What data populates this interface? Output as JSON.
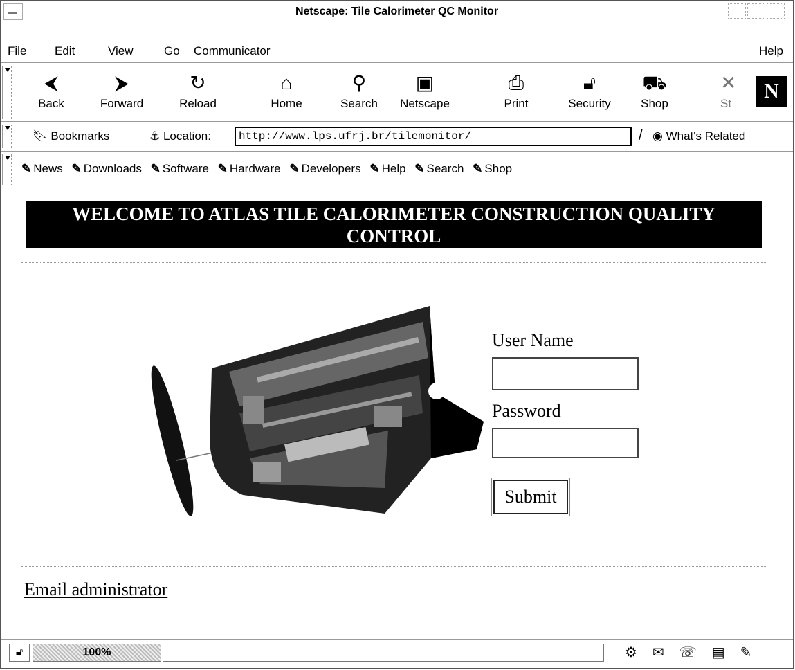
{
  "window": {
    "title": "Netscape: Tile Calorimeter QC Monitor"
  },
  "menu": {
    "file": "File",
    "edit": "Edit",
    "view": "View",
    "go": "Go",
    "communicator": "Communicator",
    "help": "Help"
  },
  "toolbar": {
    "back": "Back",
    "forward": "Forward",
    "reload": "Reload",
    "home": "Home",
    "search": "Search",
    "netscape": "Netscape",
    "print": "Print",
    "security": "Security",
    "shop": "Shop",
    "stop": "St"
  },
  "location": {
    "bookmarks": "Bookmarks",
    "label": "Location:",
    "url": "http://www.lps.ufrj.br/tilemonitor/",
    "whats_related": "What's Related"
  },
  "personal": {
    "news": "News",
    "downloads": "Downloads",
    "software": "Software",
    "hardware": "Hardware",
    "developers": "Developers",
    "help": "Help",
    "search": "Search",
    "shop": "Shop"
  },
  "page": {
    "banner": "WELCOME TO ATLAS TILE CALORIMETER CONSTRUCTION QUALITY CONTROL",
    "username_label": "User Name",
    "username_value": "",
    "password_label": "Password",
    "password_value": "",
    "submit": "Submit",
    "email_link": "Email administrator"
  },
  "status": {
    "progress": "100%",
    "message": ""
  }
}
